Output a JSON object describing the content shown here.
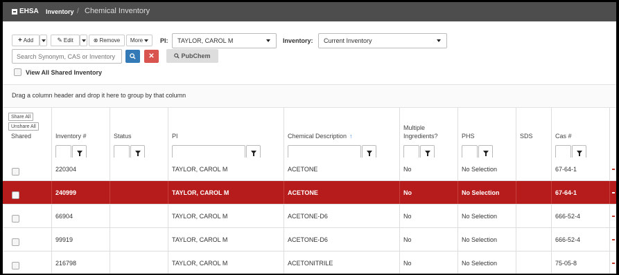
{
  "topbar": {
    "brand": "EHSA",
    "breadcrumb": [
      "Inventory",
      "Chemical Inventory"
    ],
    "separator": "/"
  },
  "toolbar": {
    "add_label": "Add",
    "edit_label": "Edit",
    "remove_label": "Remove",
    "more_label": "More",
    "pi_label": "PI:",
    "pi_value": "TAYLOR, CAROL M",
    "inventory_label": "Inventory:",
    "inventory_value": "Current Inventory",
    "search_placeholder": "Search Synonym, CAS or Inventory",
    "pubchem_label": "PubChem",
    "view_all_label": "View All Shared Inventory"
  },
  "groupbar": {
    "hint": "Drag a column header and drop it here to group by that column"
  },
  "grid": {
    "shared_buttons": [
      "Share All",
      "Unshare All"
    ],
    "columns": [
      "Shared",
      "Inventory #",
      "Status",
      "PI",
      "Chemical Description",
      "Multiple Ingredients?",
      "PHS",
      "SDS",
      "Cas #"
    ],
    "sort_indicator": "↑",
    "rows": [
      {
        "inventory": "220304",
        "status": "",
        "pi": "TAYLOR, CAROL M",
        "chemical": "ACETONE",
        "multiple": "No",
        "phs": "No Selection",
        "sds": "",
        "cas": "67-64-1",
        "selected": false
      },
      {
        "inventory": "240999",
        "status": "",
        "pi": "TAYLOR, CAROL M",
        "chemical": "ACETONE",
        "multiple": "No",
        "phs": "No Selection",
        "sds": "",
        "cas": "67-64-1",
        "selected": true
      },
      {
        "inventory": "66904",
        "status": "",
        "pi": "TAYLOR, CAROL M",
        "chemical": "ACETONE-D6",
        "multiple": "No",
        "phs": "No Selection",
        "sds": "",
        "cas": "666-52-4",
        "selected": false
      },
      {
        "inventory": "99919",
        "status": "",
        "pi": "TAYLOR, CAROL M",
        "chemical": "ACETONE-D6",
        "multiple": "No",
        "phs": "No Selection",
        "sds": "",
        "cas": "666-52-4",
        "selected": false
      },
      {
        "inventory": "216798",
        "status": "",
        "pi": "TAYLOR, CAROL M",
        "chemical": "ACETONITRILE",
        "multiple": "No",
        "phs": "No Selection",
        "sds": "",
        "cas": "75-05-8",
        "selected": false
      }
    ]
  },
  "colors": {
    "topbar": "#4d4d4d",
    "selected_row": "#b71c1c",
    "primary_button": "#337ab7",
    "danger_button": "#d9534f"
  }
}
